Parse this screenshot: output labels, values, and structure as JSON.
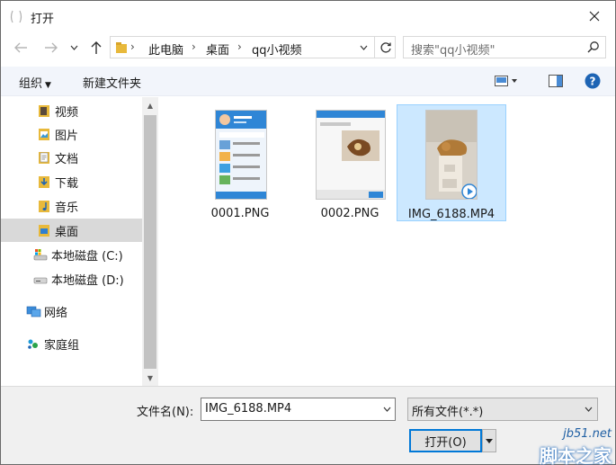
{
  "window": {
    "title": "打开"
  },
  "address": {
    "crumbs": [
      "此电脑",
      "桌面",
      "qq小视频"
    ],
    "search_placeholder": "搜索\"qq小视频\""
  },
  "toolbar": {
    "organize_label": "组织",
    "new_folder_label": "新建文件夹"
  },
  "sidebar": {
    "items": [
      {
        "label": "视频",
        "icon": "video-folder-icon"
      },
      {
        "label": "图片",
        "icon": "pictures-folder-icon"
      },
      {
        "label": "文档",
        "icon": "documents-folder-icon"
      },
      {
        "label": "下载",
        "icon": "downloads-folder-icon"
      },
      {
        "label": "音乐",
        "icon": "music-folder-icon"
      },
      {
        "label": "桌面",
        "icon": "desktop-folder-icon",
        "selected": true
      },
      {
        "label": "本地磁盘 (C:)",
        "icon": "system-drive-icon"
      },
      {
        "label": "本地磁盘 (D:)",
        "icon": "drive-icon"
      },
      {
        "label": "网络",
        "icon": "network-icon"
      },
      {
        "label": "家庭组",
        "icon": "homegroup-icon"
      }
    ]
  },
  "files": [
    {
      "name": "0001.PNG",
      "type": "image"
    },
    {
      "name": "0002.PNG",
      "type": "image"
    },
    {
      "name": "IMG_6188.MP4",
      "type": "video",
      "selected": true
    }
  ],
  "footer": {
    "filename_label": "文件名(N):",
    "filename_value": "IMG_6188.MP4",
    "filetype_value": "所有文件(*.*)",
    "open_label": "打开(O)"
  },
  "watermark": {
    "site": "jb51.net",
    "text": "脚本之家"
  },
  "colors": {
    "accent": "#0078d7",
    "selection": "#cce8ff",
    "help": "#1e64b4"
  }
}
